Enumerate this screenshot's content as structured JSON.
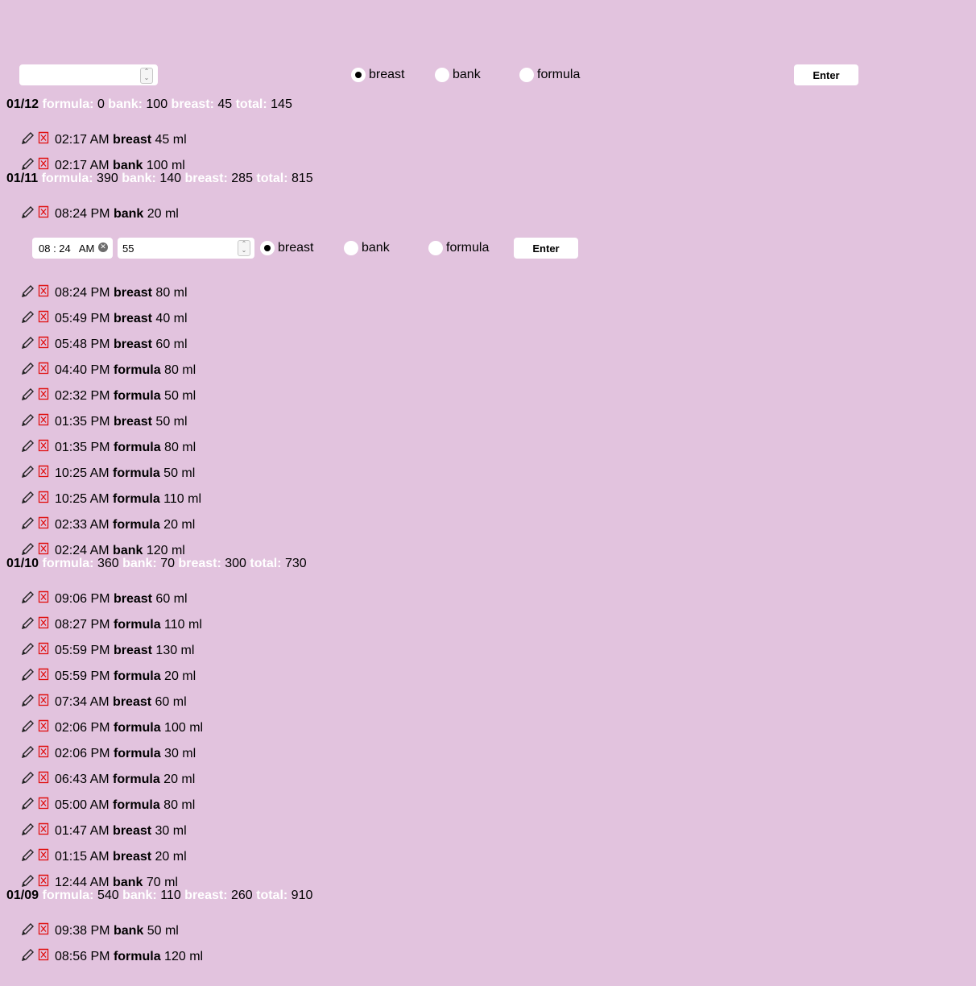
{
  "form": {
    "quantity_value": "",
    "options": [
      "breast",
      "bank",
      "formula"
    ],
    "selected": "breast",
    "enter_label": "Enter"
  },
  "edit_form": {
    "time_value": "08 : 24   AM",
    "quantity_value": "55",
    "options": [
      "breast",
      "bank",
      "formula"
    ],
    "selected": "breast",
    "enter_label": "Enter"
  },
  "stat_labels": {
    "formula": "formula:",
    "bank": "bank:",
    "breast": "breast:",
    "total": "total:"
  },
  "days": [
    {
      "date": "01/12",
      "formula": "0",
      "bank": "100",
      "breast": "45",
      "total": "145",
      "entries": [
        {
          "time": "02:17 AM",
          "type": "breast",
          "amount": "45 ml"
        },
        {
          "time": "02:17 AM",
          "type": "bank",
          "amount": "100 ml"
        }
      ]
    },
    {
      "date": "01/11",
      "formula": "390",
      "bank": "140",
      "breast": "285",
      "total": "815",
      "entries": [
        {
          "time": "08:24 PM",
          "type": "bank",
          "amount": "20 ml"
        },
        {
          "time": "08:24 PM",
          "type": "breast",
          "amount": "80 ml"
        },
        {
          "time": "05:49 PM",
          "type": "breast",
          "amount": "40 ml"
        },
        {
          "time": "05:48 PM",
          "type": "breast",
          "amount": "60 ml"
        },
        {
          "time": "04:40 PM",
          "type": "formula",
          "amount": "80 ml"
        },
        {
          "time": "02:32 PM",
          "type": "formula",
          "amount": "50 ml"
        },
        {
          "time": "01:35 PM",
          "type": "breast",
          "amount": "50 ml"
        },
        {
          "time": "01:35 PM",
          "type": "formula",
          "amount": "80 ml"
        },
        {
          "time": "10:25 AM",
          "type": "formula",
          "amount": "50 ml"
        },
        {
          "time": "10:25 AM",
          "type": "formula",
          "amount": "110 ml"
        },
        {
          "time": "02:33 AM",
          "type": "formula",
          "amount": "20 ml"
        },
        {
          "time": "02:24 AM",
          "type": "bank",
          "amount": "120 ml"
        }
      ]
    },
    {
      "date": "01/10",
      "formula": "360",
      "bank": "70",
      "breast": "300",
      "total": "730",
      "entries": [
        {
          "time": "09:06 PM",
          "type": "breast",
          "amount": "60 ml"
        },
        {
          "time": "08:27 PM",
          "type": "formula",
          "amount": "110 ml"
        },
        {
          "time": "05:59 PM",
          "type": "breast",
          "amount": "130 ml"
        },
        {
          "time": "05:59 PM",
          "type": "formula",
          "amount": "20 ml"
        },
        {
          "time": "07:34 AM",
          "type": "breast",
          "amount": "60 ml"
        },
        {
          "time": "02:06 PM",
          "type": "formula",
          "amount": "100 ml"
        },
        {
          "time": "02:06 PM",
          "type": "formula",
          "amount": "30 ml"
        },
        {
          "time": "06:43 AM",
          "type": "formula",
          "amount": "20 ml"
        },
        {
          "time": "05:00 AM",
          "type": "formula",
          "amount": "80 ml"
        },
        {
          "time": "01:47 AM",
          "type": "breast",
          "amount": "30 ml"
        },
        {
          "time": "01:15 AM",
          "type": "breast",
          "amount": "20 ml"
        },
        {
          "time": "12:44 AM",
          "type": "bank",
          "amount": "70 ml"
        }
      ]
    },
    {
      "date": "01/09",
      "formula": "540",
      "bank": "110",
      "breast": "260",
      "total": "910",
      "entries": [
        {
          "time": "09:38 PM",
          "type": "bank",
          "amount": "50 ml"
        },
        {
          "time": "08:56 PM",
          "type": "formula",
          "amount": "120 ml"
        }
      ]
    }
  ]
}
